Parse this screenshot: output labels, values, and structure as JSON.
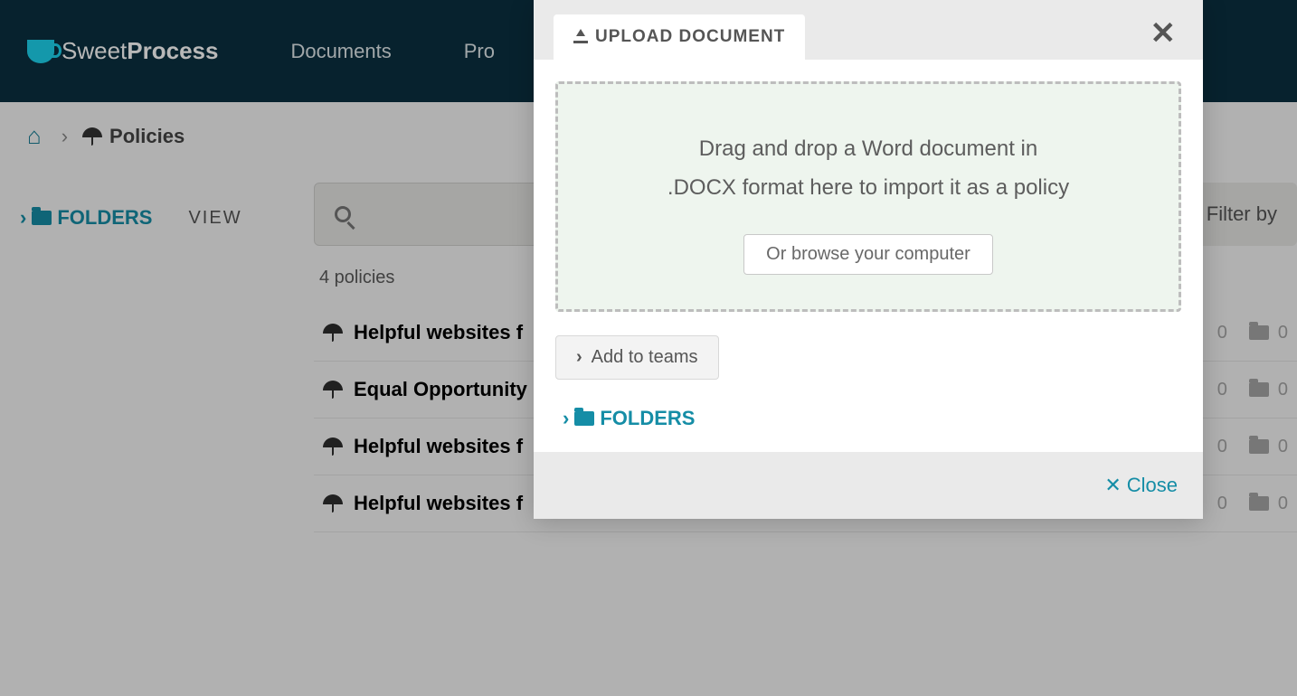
{
  "logo": {
    "prefix": "Sweet",
    "suffix": "Process"
  },
  "nav": {
    "documents": "Documents",
    "processes": "Pro"
  },
  "breadcrumb": {
    "page": "Policies"
  },
  "sidebar": {
    "folders": "FOLDERS",
    "view": "VIEW"
  },
  "main": {
    "search_placeholder": "",
    "filter_label": "Filter by",
    "count_text": "4 policies",
    "rows": [
      {
        "title": "Helpful websites f",
        "count1": "0",
        "count2": "0"
      },
      {
        "title": "Equal Opportunity",
        "count1": "0",
        "count2": "0"
      },
      {
        "title": "Helpful websites f",
        "count1": "0",
        "count2": "0"
      },
      {
        "title": "Helpful websites f",
        "count1": "0",
        "count2": "0"
      }
    ]
  },
  "modal": {
    "tab_label": "UPLOAD DOCUMENT",
    "drop_line1": "Drag and drop a Word document in",
    "drop_line2": ".DOCX format here to import it as a policy",
    "browse": "Or browse your computer",
    "add_teams": "Add to teams",
    "folders": "FOLDERS",
    "close": "Close"
  }
}
